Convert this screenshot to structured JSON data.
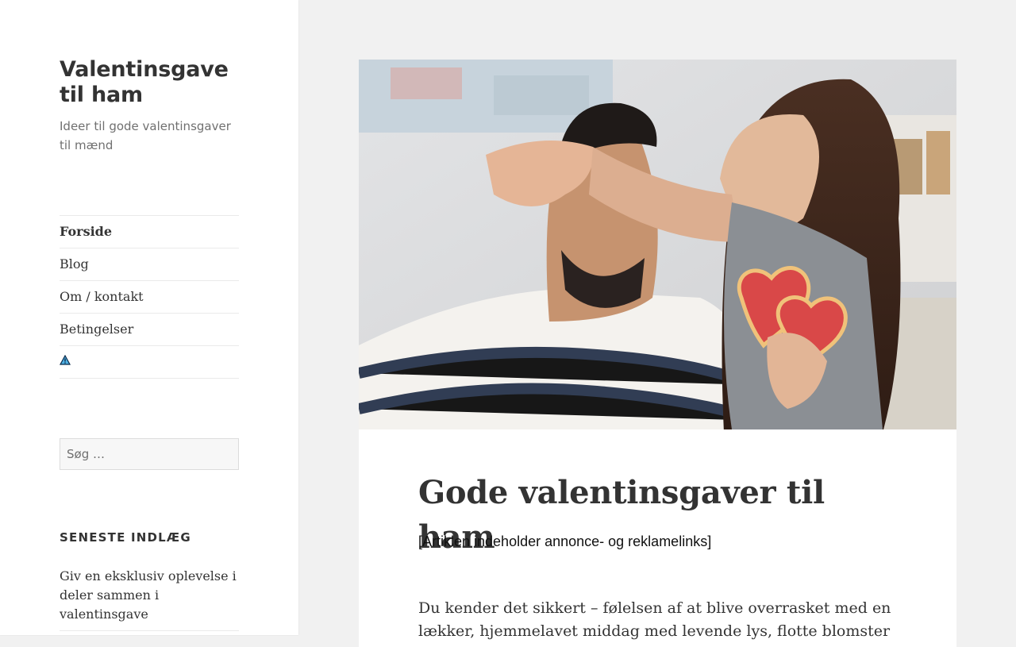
{
  "site": {
    "title": "Valentinsgave til ham",
    "description": "Ideer til gode valentinsgaver til mænd"
  },
  "nav": {
    "items": [
      {
        "label": "Forside"
      },
      {
        "label": "Blog"
      },
      {
        "label": "Om / kontakt"
      },
      {
        "label": "Betingelser"
      }
    ],
    "extra_icon": "warning-triangle-icon"
  },
  "search": {
    "placeholder": "Søg …",
    "value": ""
  },
  "recent_posts": {
    "heading": "SENESTE INDLÆG",
    "items": [
      {
        "label": "Giv en eksklusiv oplevelse i deler sammen i valentinsgave"
      }
    ]
  },
  "article": {
    "title": "Gode valentinsgaver til ham",
    "disclaimer": "[Artiklen indeholder annonce- og reklamelinks]",
    "intro": "Du kender det sikkert – følelsen af at blive overrasket med en lækker, hjemmelavet middag med levende lys, flotte blomster"
  },
  "colors": {
    "sidebar_bg": "#ffffff",
    "page_bg": "#f1f1f1",
    "text": "#333333",
    "muted": "#707070"
  }
}
